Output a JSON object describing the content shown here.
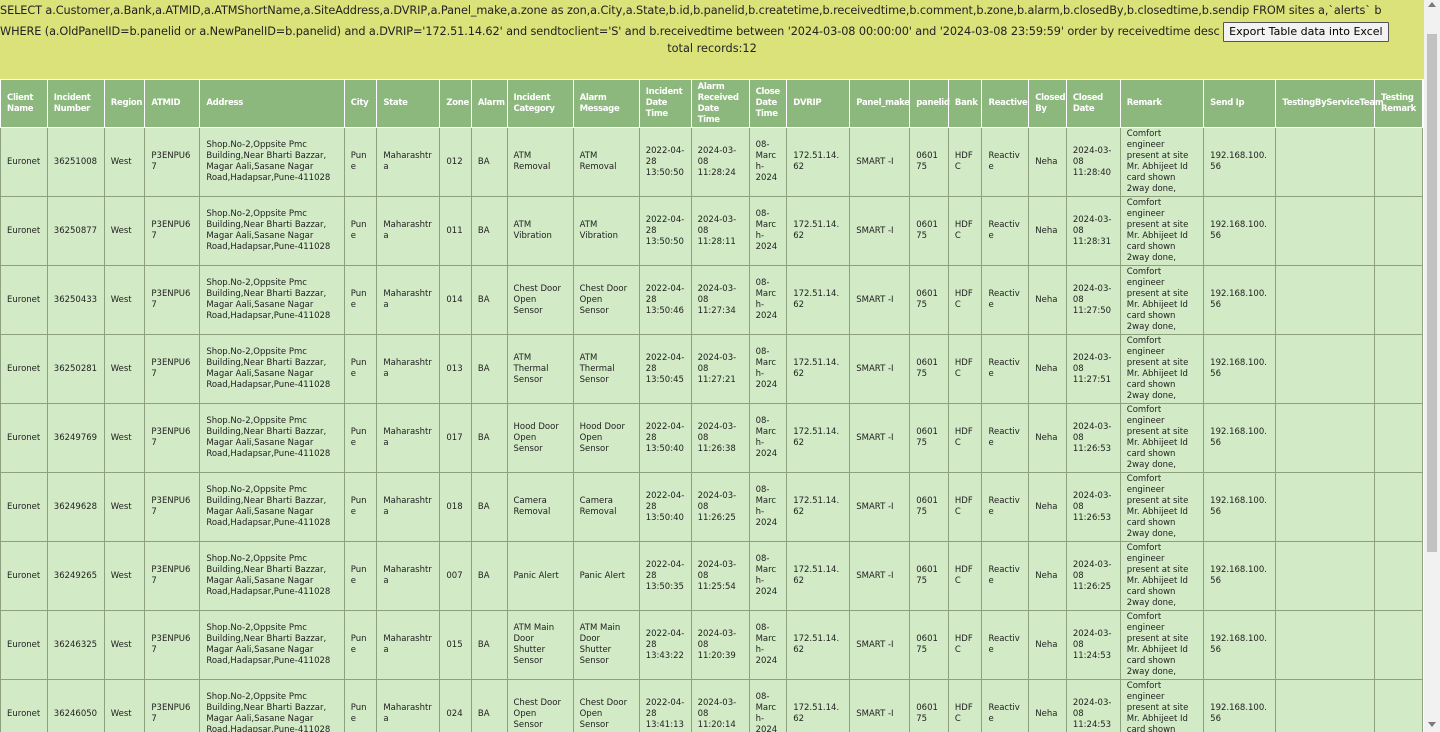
{
  "sql_query": "SELECT a.Customer,a.Bank,a.ATMID,a.ATMShortName,a.SiteAddress,a.DVRIP,a.Panel_make,a.zone as zon,a.City,a.State,b.id,b.panelid,b.createtime,b.receivedtime,b.comment,b.zone,b.alarm,b.closedBy,b.closedtime,b.sendip FROM sites a,`alerts` b WHERE (a.OldPanelID=b.panelid or a.NewPanelID=b.panelid) and a.DVRIP='172.51.14.62' and sendtoclient='S' and b.receivedtime between '2024-03-08 00:00:00' and '2024-03-08 23:59:59' order by receivedtime desc",
  "export_button": "Export Table data into Excel",
  "total_records": "total records:12",
  "colors": {
    "header_bg": "#dbe27a",
    "th_bg": "#8db87d",
    "td_bg": "#d2eac5"
  },
  "columns": [
    "Client Name",
    "Incident Number",
    "Region",
    "ATMID",
    "Address",
    "City",
    "State",
    "Zone",
    "Alarm",
    "Incident Category",
    "Alarm Message",
    "Incident Date Time",
    "Alarm Received Date Time",
    "Close Date Time",
    "DVRIP",
    "Panel_make",
    "panelid",
    "Bank",
    "Reactive",
    "Closed By",
    "Closed Date",
    "Remark",
    "Send Ip",
    "TestingByServiceTeam",
    "Testing Remark"
  ],
  "rows": [
    [
      "Euronet",
      "36251008",
      "West",
      "P3ENPU67",
      "Shop.No-2,Oppsite Pmc Building,Near Bharti Bazzar, Magar Aali,Sasane Nagar Road,Hadapsar,Pune-411028",
      "Pune",
      "Maharashtra",
      "012",
      "BA",
      "ATM Removal",
      "ATM Removal",
      "2022-04-28 13:50:50",
      "2024-03-08 11:28:24",
      "08-March-2024",
      "172.51.14.62",
      "SMART -I",
      "060175",
      "HDFC",
      "Reactive",
      "Neha",
      "2024-03-08 11:28:40",
      "Comfort engineer present at site Mr. Abhijeet Id card shown 2way done,",
      "192.168.100.56",
      "",
      ""
    ],
    [
      "Euronet",
      "36250877",
      "West",
      "P3ENPU67",
      "Shop.No-2,Oppsite Pmc Building,Near Bharti Bazzar, Magar Aali,Sasane Nagar Road,Hadapsar,Pune-411028",
      "Pune",
      "Maharashtra",
      "011",
      "BA",
      "ATM Vibration",
      "ATM Vibration",
      "2022-04-28 13:50:50",
      "2024-03-08 11:28:11",
      "08-March-2024",
      "172.51.14.62",
      "SMART -I",
      "060175",
      "HDFC",
      "Reactive",
      "Neha",
      "2024-03-08 11:28:31",
      "Comfort engineer present at site Mr. Abhijeet Id card shown 2way done,",
      "192.168.100.56",
      "",
      ""
    ],
    [
      "Euronet",
      "36250433",
      "West",
      "P3ENPU67",
      "Shop.No-2,Oppsite Pmc Building,Near Bharti Bazzar, Magar Aali,Sasane Nagar Road,Hadapsar,Pune-411028",
      "Pune",
      "Maharashtra",
      "014",
      "BA",
      "Chest Door Open Sensor",
      "Chest Door Open Sensor",
      "2022-04-28 13:50:46",
      "2024-03-08 11:27:34",
      "08-March-2024",
      "172.51.14.62",
      "SMART -I",
      "060175",
      "HDFC",
      "Reactive",
      "Neha",
      "2024-03-08 11:27:50",
      "Comfort engineer present at site Mr. Abhijeet Id card shown 2way done,",
      "192.168.100.56",
      "",
      ""
    ],
    [
      "Euronet",
      "36250281",
      "West",
      "P3ENPU67",
      "Shop.No-2,Oppsite Pmc Building,Near Bharti Bazzar, Magar Aali,Sasane Nagar Road,Hadapsar,Pune-411028",
      "Pune",
      "Maharashtra",
      "013",
      "BA",
      "ATM Thermal Sensor",
      "ATM Thermal Sensor",
      "2022-04-28 13:50:45",
      "2024-03-08 11:27:21",
      "08-March-2024",
      "172.51.14.62",
      "SMART -I",
      "060175",
      "HDFC",
      "Reactive",
      "Neha",
      "2024-03-08 11:27:51",
      "Comfort engineer present at site Mr. Abhijeet Id card shown 2way done,",
      "192.168.100.56",
      "",
      ""
    ],
    [
      "Euronet",
      "36249769",
      "West",
      "P3ENPU67",
      "Shop.No-2,Oppsite Pmc Building,Near Bharti Bazzar, Magar Aali,Sasane Nagar Road,Hadapsar,Pune-411028",
      "Pune",
      "Maharashtra",
      "017",
      "BA",
      "Hood Door Open Sensor",
      "Hood Door Open Sensor",
      "2022-04-28 13:50:40",
      "2024-03-08 11:26:38",
      "08-March-2024",
      "172.51.14.62",
      "SMART -I",
      "060175",
      "HDFC",
      "Reactive",
      "Neha",
      "2024-03-08 11:26:53",
      "Comfort engineer present at site Mr. Abhijeet Id card shown 2way done,",
      "192.168.100.56",
      "",
      ""
    ],
    [
      "Euronet",
      "36249628",
      "West",
      "P3ENPU67",
      "Shop.No-2,Oppsite Pmc Building,Near Bharti Bazzar, Magar Aali,Sasane Nagar Road,Hadapsar,Pune-411028",
      "Pune",
      "Maharashtra",
      "018",
      "BA",
      "Camera Removal",
      "Camera Removal",
      "2022-04-28 13:50:40",
      "2024-03-08 11:26:25",
      "08-March-2024",
      "172.51.14.62",
      "SMART -I",
      "060175",
      "HDFC",
      "Reactive",
      "Neha",
      "2024-03-08 11:26:53",
      "Comfort engineer present at site Mr. Abhijeet Id card shown 2way done,",
      "192.168.100.56",
      "",
      ""
    ],
    [
      "Euronet",
      "36249265",
      "West",
      "P3ENPU67",
      "Shop.No-2,Oppsite Pmc Building,Near Bharti Bazzar, Magar Aali,Sasane Nagar Road,Hadapsar,Pune-411028",
      "Pune",
      "Maharashtra",
      "007",
      "BA",
      "Panic Alert",
      "Panic Alert",
      "2022-04-28 13:50:35",
      "2024-03-08 11:25:54",
      "08-March-2024",
      "172.51.14.62",
      "SMART -I",
      "060175",
      "HDFC",
      "Reactive",
      "Neha",
      "2024-03-08 11:26:25",
      "Comfort engineer present at site Mr. Abhijeet Id card shown 2way done,",
      "192.168.100.56",
      "",
      ""
    ],
    [
      "Euronet",
      "36246325",
      "West",
      "P3ENPU67",
      "Shop.No-2,Oppsite Pmc Building,Near Bharti Bazzar, Magar Aali,Sasane Nagar Road,Hadapsar,Pune-411028",
      "Pune",
      "Maharashtra",
      "015",
      "BA",
      "ATM Main Door Shutter Sensor",
      "ATM Main Door Shutter Sensor",
      "2022-04-28 13:43:22",
      "2024-03-08 11:20:39",
      "08-March-2024",
      "172.51.14.62",
      "SMART -I",
      "060175",
      "HDFC",
      "Reactive",
      "Neha",
      "2024-03-08 11:24:53",
      "Comfort engineer present at site Mr. Abhijeet Id card shown 2way done,",
      "192.168.100.56",
      "",
      ""
    ],
    [
      "Euronet",
      "36246050",
      "West",
      "P3ENPU67",
      "Shop.No-2,Oppsite Pmc Building,Near Bharti Bazzar, Magar Aali,Sasane Nagar Road,Hadapsar,Pune-411028",
      "Pune",
      "Maharashtra",
      "024",
      "BA",
      "Chest Door Open Sensor",
      "Chest Door Open Sensor",
      "2022-04-28 13:41:13",
      "2024-03-08 11:20:14",
      "08-March-2024",
      "172.51.14.62",
      "SMART -I",
      "060175",
      "HDFC",
      "Reactive",
      "Neha",
      "2024-03-08 11:24:53",
      "Comfort engineer present at site Mr. Abhijeet Id card shown 2way done,",
      "192.168.100.56",
      "",
      ""
    ]
  ]
}
